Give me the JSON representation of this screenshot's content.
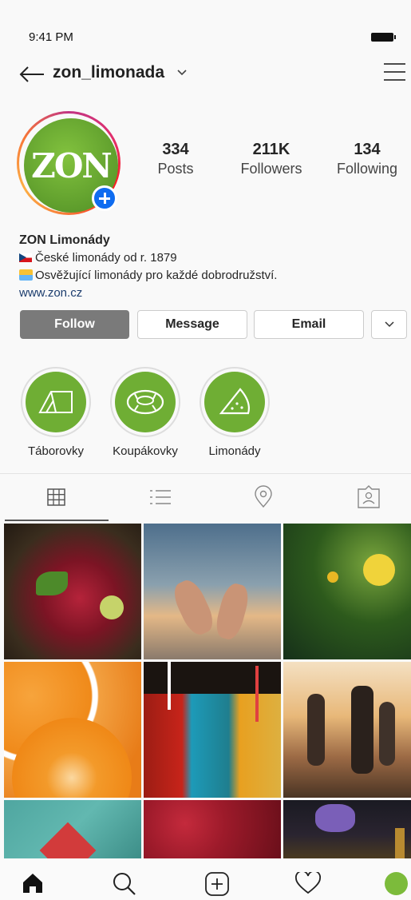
{
  "status_bar": {
    "time": "9:41 PM"
  },
  "header": {
    "username": "zon_limonada"
  },
  "profile": {
    "avatar_text": "ZON",
    "stats": [
      {
        "value": "334",
        "label": "Posts"
      },
      {
        "value": "211K",
        "label": "Followers"
      },
      {
        "value": "134",
        "label": "Following"
      }
    ],
    "name": "ZON Limonády",
    "bio_line1": "České limonády od r. 1879",
    "bio_line2": "Osvěžující limonády pro každé dobrodružství.",
    "link": "www.zon.cz"
  },
  "actions": {
    "follow": "Follow",
    "message": "Message",
    "email": "Email"
  },
  "highlights": [
    {
      "label": "Táborovky",
      "icon": "tent-icon"
    },
    {
      "label": "Koupákovky",
      "icon": "swim-ring-icon"
    },
    {
      "label": "Limonády",
      "icon": "watermelon-slice-icon"
    }
  ],
  "tabs": [
    "grid-icon",
    "list-icon",
    "location-pin-icon",
    "tagged-icon"
  ],
  "colors": {
    "brand_green": "#6fae34",
    "follow_button": "#7a7a7a",
    "link": "#1c3d6e",
    "plus_badge": "#0f6cf0"
  }
}
